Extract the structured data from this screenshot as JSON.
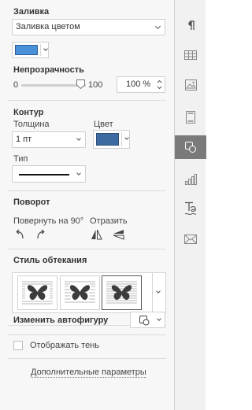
{
  "fill": {
    "title": "Заливка",
    "type_value": "Заливка цветом",
    "color": "#4a90d9"
  },
  "opacity": {
    "title": "Непрозрачность",
    "slider_min": "0",
    "slider_max": "100",
    "value_text": "100 %",
    "level": 1.0
  },
  "stroke": {
    "title": "Контур",
    "width_label": "Толщина",
    "width_value": "1 пт",
    "color_label": "Цвет",
    "color": "#3d6aa0",
    "type_label": "Тип"
  },
  "rotation": {
    "title": "Поворот",
    "rotate_label": "Повернуть на 90°",
    "flip_label": "Отразить"
  },
  "wrapping": {
    "title": "Стиль обтекания",
    "selected_index": 2
  },
  "autoshape": {
    "label": "Изменить автофигуру"
  },
  "shadow": {
    "label": "Отображать тень",
    "checked": false
  },
  "advanced": {
    "link": "Дополнительные параметры"
  },
  "sidebar": {
    "items": [
      {
        "icon": "paragraph-icon"
      },
      {
        "icon": "table-icon"
      },
      {
        "icon": "image-icon"
      },
      {
        "icon": "header-footer-icon"
      },
      {
        "icon": "shape-icon",
        "active": true
      },
      {
        "icon": "chart-icon"
      },
      {
        "icon": "text-art-icon"
      },
      {
        "icon": "mail-merge-icon"
      }
    ]
  }
}
